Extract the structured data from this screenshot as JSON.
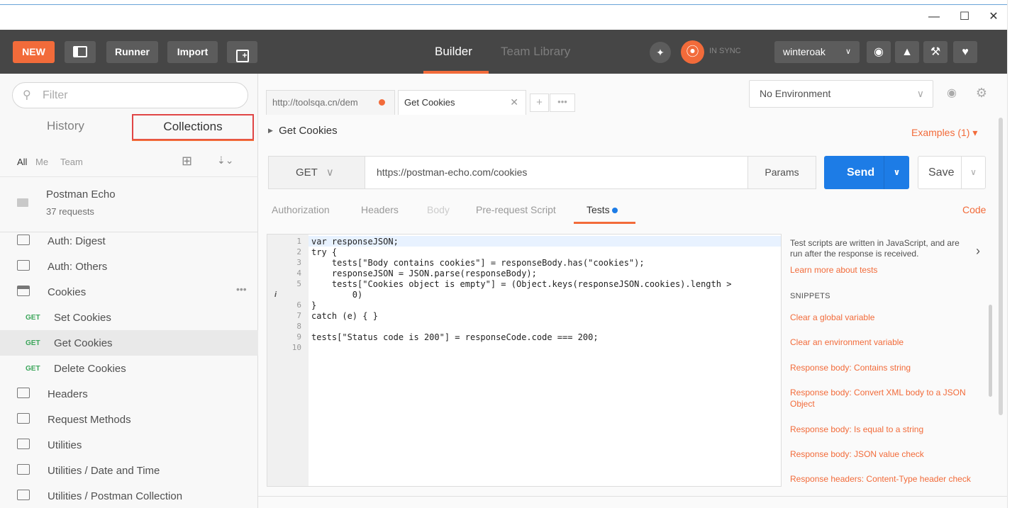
{
  "window": {
    "minimize": "—",
    "maximize": "☐",
    "close": "✕"
  },
  "header": {
    "new_label": "NEW",
    "runner_label": "Runner",
    "import_label": "Import",
    "nav_builder": "Builder",
    "nav_team_library": "Team Library",
    "sync_status": "IN SYNC",
    "user": "winteroak",
    "accent_color": "#f26b3a"
  },
  "sidebar": {
    "filter_placeholder": "Filter",
    "tab_history": "History",
    "tab_collections": "Collections",
    "filter_all": "All",
    "filter_me": "Me",
    "filter_team": "Team",
    "collection": {
      "name": "Postman Echo",
      "count": "37 requests"
    },
    "items": [
      {
        "label": "Auth: Digest"
      },
      {
        "label": "Auth: Others"
      },
      {
        "label": "Cookies"
      },
      {
        "method": "GET",
        "label": "Set Cookies"
      },
      {
        "method": "GET",
        "label": "Get Cookies"
      },
      {
        "method": "GET",
        "label": "Delete Cookies"
      },
      {
        "label": "Headers"
      },
      {
        "label": "Request Methods"
      },
      {
        "label": "Utilities"
      },
      {
        "label": "Utilities / Date and Time"
      },
      {
        "label": "Utilities / Postman Collection"
      }
    ]
  },
  "tabs": [
    {
      "label": "http://toolsqa.cn/dem"
    },
    {
      "label": "Get Cookies"
    }
  ],
  "environment": {
    "selected": "No Environment"
  },
  "request": {
    "title": "Get Cookies",
    "examples": "Examples (1) ▾",
    "method": "GET",
    "url": "https://postman-echo.com/cookies",
    "params_label": "Params",
    "send_label": "Send",
    "save_label": "Save"
  },
  "request_tabs": {
    "authorization": "Authorization",
    "headers": "Headers",
    "body": "Body",
    "prerequest": "Pre-request Script",
    "tests": "Tests",
    "code": "Code"
  },
  "editor": {
    "line_numbers": [
      "1",
      "2",
      "3",
      "4",
      "5",
      "6",
      "7",
      "8",
      "9",
      "10"
    ],
    "lines": [
      "var responseJSON;",
      "try {",
      "    tests[\"Body contains cookies\"] = responseBody.has(\"cookies\");",
      "    responseJSON = JSON.parse(responseBody);",
      "    tests[\"Cookies object is empty\"] = (Object.keys(responseJSON.cookies).length >",
      "        0)",
      "}",
      "catch (e) { }",
      "",
      "tests[\"Status code is 200\"] = responseCode.code === 200;",
      ""
    ]
  },
  "snippets": {
    "description": "Test scripts are written in JavaScript, and are run after the response is received.",
    "learn_more": "Learn more about tests",
    "heading": "SNIPPETS",
    "items": [
      "Clear a global variable",
      "Clear an environment variable",
      "Response body: Contains string",
      "Response body: Convert XML body to a JSON Object",
      "Response body: Is equal to a string",
      "Response body: JSON value check",
      "Response headers: Content-Type header check"
    ]
  }
}
